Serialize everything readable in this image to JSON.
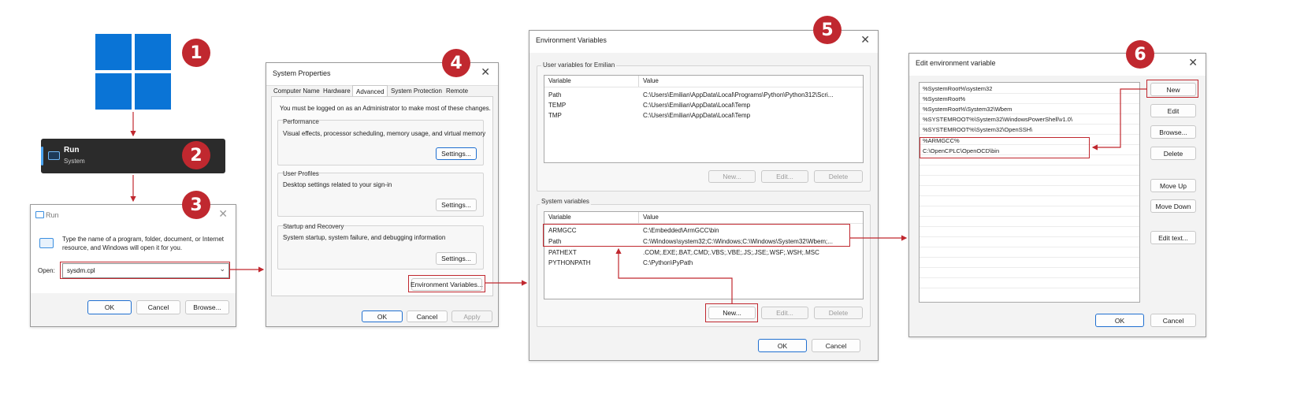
{
  "steps": [
    "1",
    "2",
    "3",
    "4",
    "5",
    "6"
  ],
  "colors": {
    "accent_red": "#c0282f",
    "windows_blue": "#0a74d6",
    "primary_border": "#1f6fd0"
  },
  "start_menu": {
    "logo_icon": "windows-logo-icon"
  },
  "search_result": {
    "title": "Run",
    "subtitle": "System",
    "icon": "run-app-icon"
  },
  "run_dialog": {
    "title": "Run",
    "description": "Type the name of a program, folder, document, or Internet resource, and Windows will open it for you.",
    "open_label": "Open:",
    "open_value": "sysdm.cpl",
    "ok": "OK",
    "cancel": "Cancel",
    "browse": "Browse..."
  },
  "system_properties": {
    "title": "System Properties",
    "tabs": [
      "Computer Name",
      "Hardware",
      "Advanced",
      "System Protection",
      "Remote"
    ],
    "admin_note": "You must be logged on as an Administrator to make most of these changes.",
    "performance": {
      "label": "Performance",
      "text": "Visual effects, processor scheduling, memory usage, and virtual memory",
      "button": "Settings..."
    },
    "user_profiles": {
      "label": "User Profiles",
      "text": "Desktop settings related to your sign-in",
      "button": "Settings..."
    },
    "startup": {
      "label": "Startup and Recovery",
      "text": "System startup, system failure, and debugging information",
      "button": "Settings..."
    },
    "env_button": "Environment Variables...",
    "ok": "OK",
    "cancel": "Cancel",
    "apply": "Apply"
  },
  "env_vars": {
    "title": "Environment Variables",
    "user_label": "User variables for Emilian",
    "columns": [
      "Variable",
      "Value"
    ],
    "user_rows": [
      {
        "variable": "Path",
        "value": "C:\\Users\\Emilian\\AppData\\Local\\Programs\\Python\\Python312\\Scri..."
      },
      {
        "variable": "TEMP",
        "value": "C:\\Users\\Emilian\\AppData\\Local\\Temp"
      },
      {
        "variable": "TMP",
        "value": "C:\\Users\\Emilian\\AppData\\Local\\Temp"
      }
    ],
    "system_label": "System variables",
    "system_rows": [
      {
        "variable": "ARMGCC",
        "value": "C:\\Embedded\\ArmGCC\\bin"
      },
      {
        "variable": "Path",
        "value": "C:\\Windows\\system32;C:\\Windows;C:\\Windows\\System32\\Wbem;..."
      },
      {
        "variable": "PATHEXT",
        "value": ".COM;.EXE;.BAT;.CMD;.VBS;.VBE;.JS;.JSE;.WSF;.WSH;.MSC"
      },
      {
        "variable": "PYTHONPATH",
        "value": "C:\\Python\\PyPath"
      }
    ],
    "new": "New...",
    "edit": "Edit...",
    "delete": "Delete",
    "ok": "OK",
    "cancel": "Cancel"
  },
  "edit_env": {
    "title": "Edit environment variable",
    "entries": [
      "%SystemRoot%\\system32",
      "%SystemRoot%",
      "%SystemRoot%\\System32\\Wbem",
      "%SYSTEMROOT%\\System32\\WindowsPowerShell\\v1.0\\",
      "%SYSTEMROOT%\\System32\\OpenSSH\\",
      "%ARMGCC%",
      "C:\\OpenCPLC\\OpenOCD\\bin"
    ],
    "buttons": {
      "new": "New",
      "edit": "Edit",
      "browse": "Browse...",
      "delete": "Delete",
      "move_up": "Move Up",
      "move_down": "Move Down",
      "edit_text": "Edit text..."
    },
    "ok": "OK",
    "cancel": "Cancel"
  }
}
